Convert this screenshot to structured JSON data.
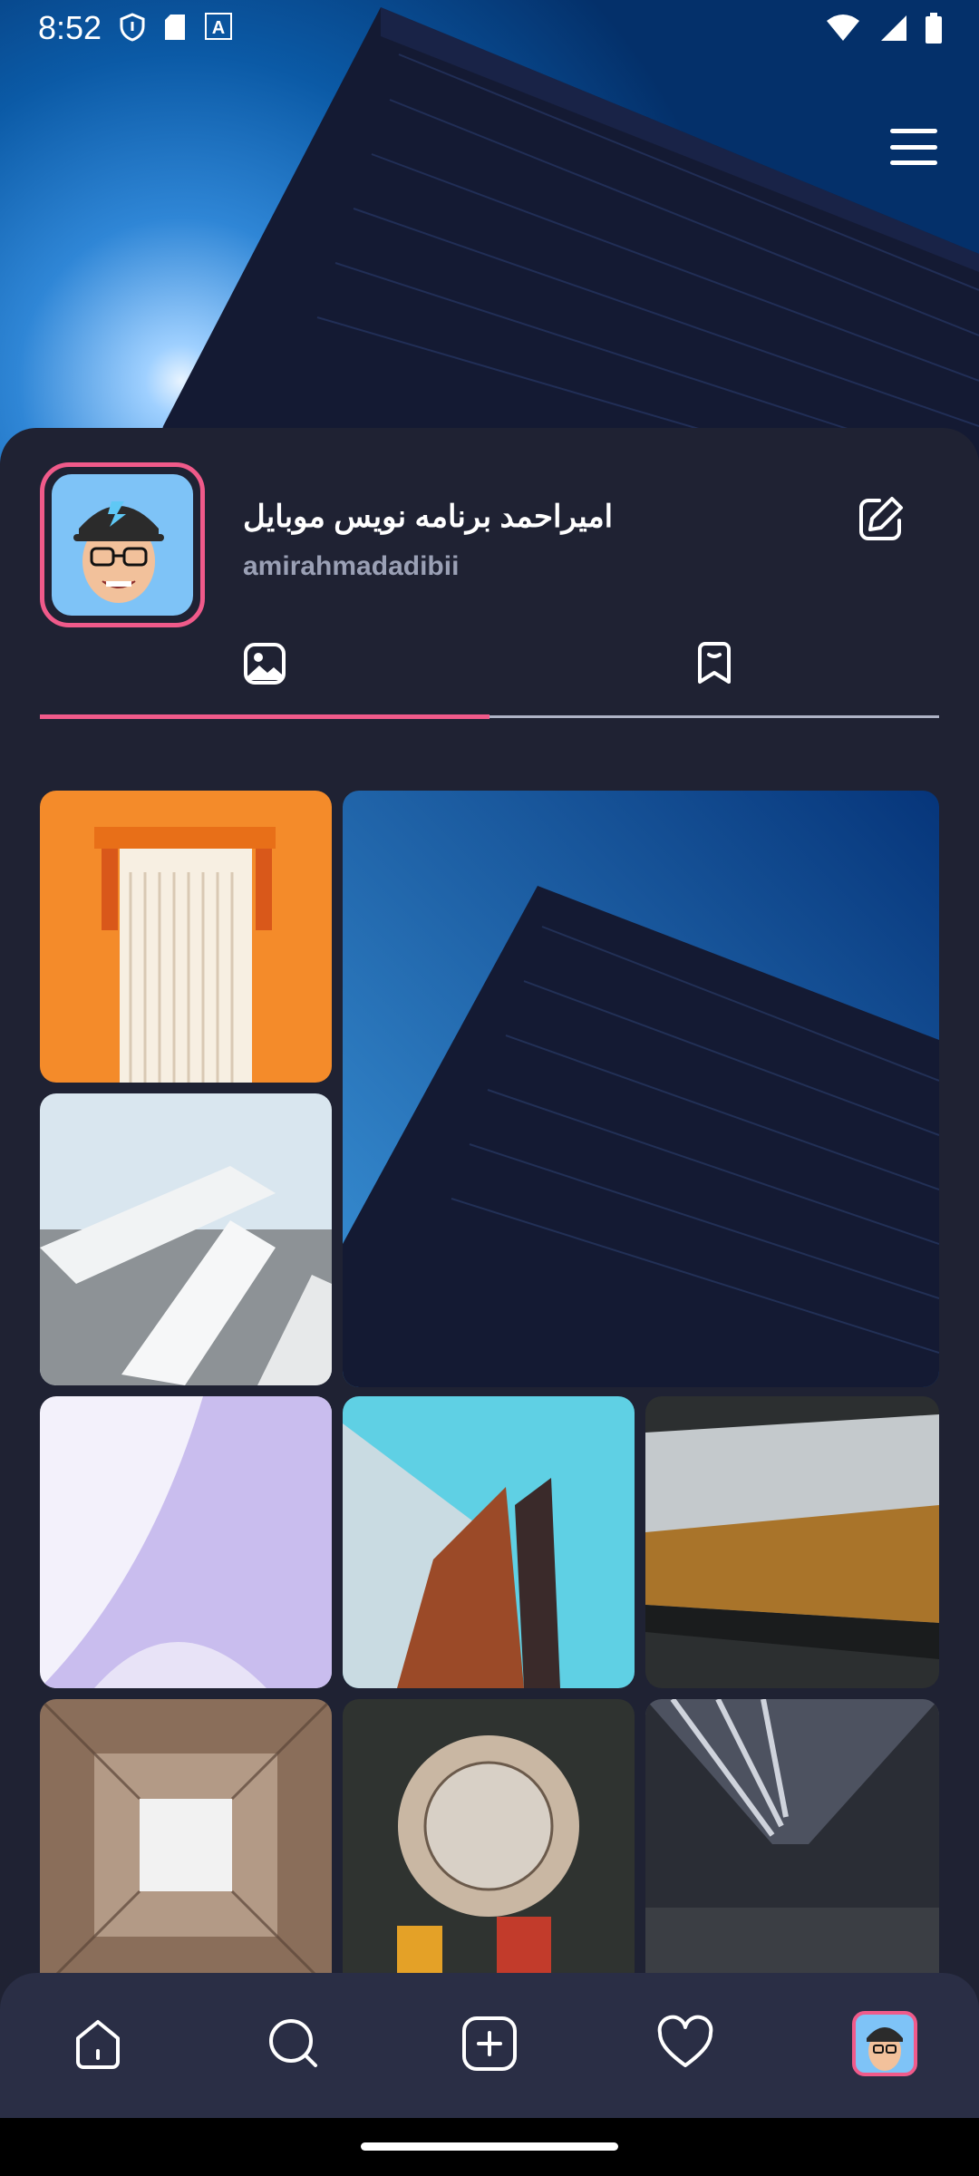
{
  "status_bar": {
    "time": "8:52",
    "icons_left": [
      "shield-icon",
      "sd-card-icon",
      "font-icon"
    ],
    "icons_right": [
      "wifi-icon",
      "signal-icon",
      "battery-icon"
    ]
  },
  "header": {
    "menu_icon": "hamburger-menu-icon"
  },
  "profile": {
    "display_name": "امیراحمد برنامه نویس موبایل",
    "username": "amirahmadadibii",
    "edit_icon": "edit-icon"
  },
  "tabs": [
    {
      "icon": "image-icon",
      "active": true
    },
    {
      "icon": "bookmark-icon",
      "active": false
    }
  ],
  "grid": {
    "tiles": [
      {
        "name": "orange-door-photo",
        "colors": [
          "#f48b2a",
          "#e06a12"
        ]
      },
      {
        "name": "dark-building-photo",
        "colors": [
          "#0b5aa6",
          "#1a2240"
        ]
      },
      {
        "name": "white-beams-photo",
        "colors": [
          "#d9e6ef",
          "#8d9296"
        ]
      },
      {
        "name": "lavender-curve-photo",
        "colors": [
          "#e7e3f7",
          "#b9a9e4"
        ]
      },
      {
        "name": "teal-facade-photo",
        "colors": [
          "#5fd0e4",
          "#9b4a28"
        ]
      },
      {
        "name": "forest-window-photo",
        "colors": [
          "#c4c9cc",
          "#a9742a"
        ]
      },
      {
        "name": "grid-ceiling-photo",
        "colors": [
          "#8a6e5a",
          "#f2f2f2"
        ]
      },
      {
        "name": "round-atrium-photo",
        "colors": [
          "#3a3f3c",
          "#c9b7a3"
        ]
      },
      {
        "name": "corridor-photo",
        "colors": [
          "#4d5260",
          "#1f2129"
        ]
      }
    ]
  },
  "bottom_nav": {
    "items": [
      {
        "icon": "home-icon"
      },
      {
        "icon": "search-icon"
      },
      {
        "icon": "add-icon"
      },
      {
        "icon": "heart-icon"
      },
      {
        "icon": "profile-avatar-icon",
        "active": true
      }
    ],
    "accent": "#f05a8a"
  },
  "colors": {
    "panel_bg": "#1f2233",
    "accent": "#f05a8a",
    "nav_bg": "#2a2e45"
  }
}
